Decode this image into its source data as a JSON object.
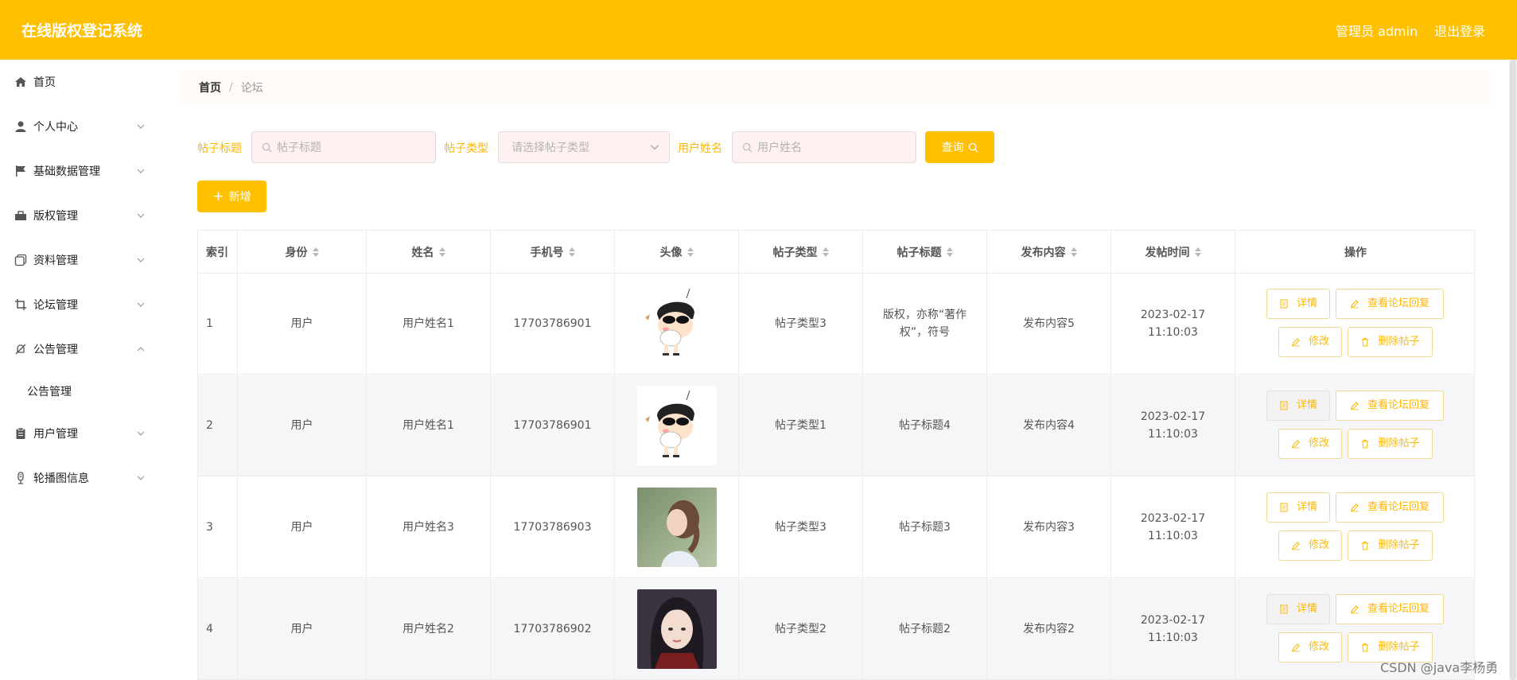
{
  "app": {
    "title": "在线版权登记系统",
    "user_label": "管理员 admin",
    "logout_label": "退出登录",
    "accent_color": "#ffc000"
  },
  "sidebar": {
    "items": [
      {
        "label": "首页",
        "icon": "home-icon"
      },
      {
        "label": "个人中心",
        "icon": "user-icon"
      },
      {
        "label": "基础数据管理",
        "icon": "flag-icon"
      },
      {
        "label": "版权管理",
        "icon": "briefcase-icon"
      },
      {
        "label": "资料管理",
        "icon": "copy-icon"
      },
      {
        "label": "论坛管理",
        "icon": "crop-icon"
      },
      {
        "label": "公告管理",
        "icon": "bell-off-icon"
      },
      {
        "label": "用户管理",
        "icon": "clipboard-icon"
      },
      {
        "label": "轮播图信息",
        "icon": "mic-icon"
      }
    ],
    "sub_items": {
      "notice": "公告管理"
    }
  },
  "breadcrumb": {
    "home": "首页",
    "current": "论坛"
  },
  "filters": {
    "title_label": "帖子标题",
    "title_placeholder": "帖子标题",
    "type_label": "帖子类型",
    "type_placeholder": "请选择帖子类型",
    "name_label": "用户姓名",
    "name_placeholder": "用户姓名",
    "search_label": "查询",
    "add_label": "新增"
  },
  "table": {
    "headers": {
      "index": "索引",
      "role": "身份",
      "name": "姓名",
      "phone": "手机号",
      "avatar": "头像",
      "type": "帖子类型",
      "title": "帖子标题",
      "content": "发布内容",
      "time": "发帖时间",
      "ops": "操作"
    },
    "actions": {
      "detail": "详情",
      "view_reply": "查看论坛回复",
      "edit": "修改",
      "delete": "删除帖子"
    },
    "rows": [
      {
        "index": "1",
        "role": "用户",
        "name": "用户姓名1",
        "phone": "17703786901",
        "avatar": "cartoon-boy",
        "type": "帖子类型3",
        "title": "版权，亦称“著作权”，符号",
        "content": "发布内容5",
        "time": "2023-02-17 11:10:03"
      },
      {
        "index": "2",
        "role": "用户",
        "name": "用户姓名1",
        "phone": "17703786901",
        "avatar": "cartoon-boy",
        "type": "帖子类型1",
        "title": "帖子标题4",
        "content": "发布内容4",
        "time": "2023-02-17 11:10:03"
      },
      {
        "index": "3",
        "role": "用户",
        "name": "用户姓名3",
        "phone": "17703786903",
        "avatar": "girl-profile-photo",
        "type": "帖子类型3",
        "title": "帖子标题3",
        "content": "发布内容3",
        "time": "2023-02-17 11:10:03"
      },
      {
        "index": "4",
        "role": "用户",
        "name": "用户姓名2",
        "phone": "17703786902",
        "avatar": "girl-portrait-photo",
        "type": "帖子类型2",
        "title": "帖子标题2",
        "content": "发布内容2",
        "time": "2023-02-17 11:10:03"
      }
    ]
  },
  "watermark": "CSDN @java李杨勇"
}
